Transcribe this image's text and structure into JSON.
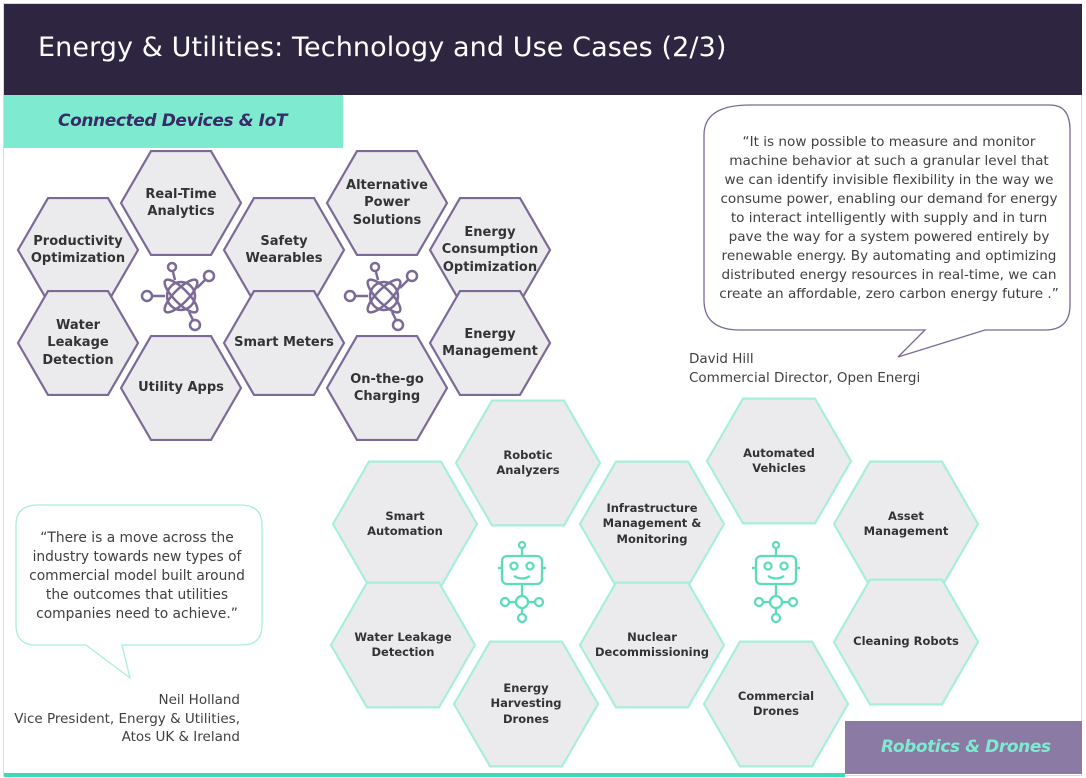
{
  "slide": {
    "title": "Energy & Utilities: Technology and Use Cases (2/3)"
  },
  "iot_section": {
    "label": "Connected Devices & IoT",
    "items": [
      "Real-Time Analytics",
      "Alternative Power Solutions",
      "Productivity Optimization",
      "Safety Wearables",
      "Energy Consumption Optimization",
      "Water Leakage Detection",
      "Smart Meters",
      "Energy Management",
      "Utility Apps",
      "On-the-go Charging"
    ],
    "icon": "atom-network-icon"
  },
  "robotics_section": {
    "label": "Robotics & Drones",
    "items": [
      "Robotic Analyzers",
      "Automated Vehicles",
      "Smart Automation",
      "Infrastructure Management & Monitoring",
      "Asset Management",
      "Water Leakage Detection",
      "Nuclear Decommissioning",
      "Cleaning Robots",
      "Energy Harvesting Drones",
      "Commercial Drones"
    ],
    "icon": "robot-drone-icon"
  },
  "quotes": [
    {
      "text": "“It is now possible to measure and monitor machine behavior at such a granular level that we can identify invisible flexibility in the way we consume power, enabling our demand for energy to interact intelligently with supply and in turn pave the way for a system powered entirely by renewable energy. By automating and optimizing distributed energy resources in real-time, we can create an affordable, zero carbon energy future .”",
      "name": "David Hill",
      "role": "Commercial Director, Open Energi"
    },
    {
      "text": "“There is a move across the industry towards new types of commercial model built around the outcomes that utilities companies need to achieve.”",
      "name": "Neil Holland",
      "role": "Vice President, Energy & Utilities,",
      "org": "Atos UK & Ireland"
    }
  ],
  "colors": {
    "header_bg": "#2e2640",
    "teal": "#7eebd0",
    "purple": "#8b7aa4",
    "hex_fill": "#ebebed"
  }
}
